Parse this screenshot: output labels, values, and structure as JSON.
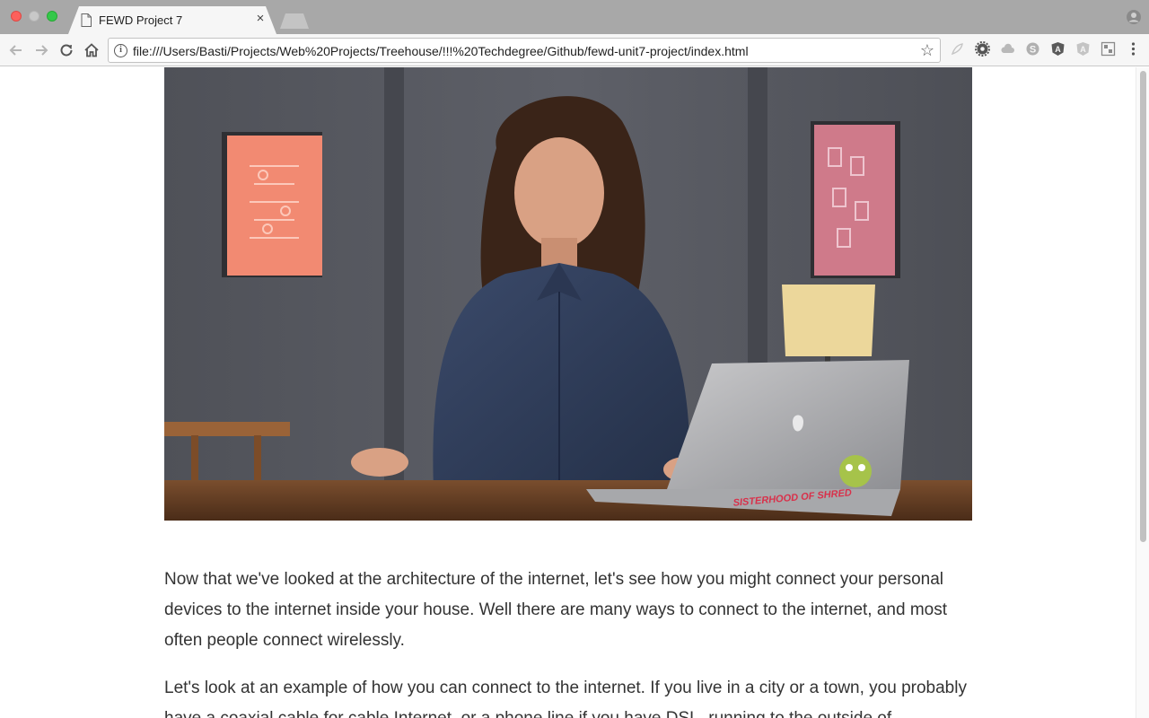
{
  "browser": {
    "tab_title": "FEWD Project 7",
    "tab_close": "×",
    "url": "file:///Users/Basti/Projects/Web%20Projects/Treehouse/!!!%20Techdegree/Github/fewd-unit7-project/index.html",
    "icons": {
      "back": "arrow-left-icon",
      "forward": "arrow-right-icon",
      "reload": "reload-icon",
      "home": "home-icon",
      "info": "info-icon",
      "bookmark": "star-icon",
      "profile": "person-icon"
    },
    "extensions": [
      "feather-icon",
      "gear-icon",
      "cloud-icon",
      "skype-icon",
      "angular-icon",
      "angular-outline-icon",
      "grid-icon",
      "menu-dots-icon"
    ]
  },
  "page": {
    "video_still": {
      "sticker_text": "SISTERHOOD OF SHRED"
    },
    "paragraphs": [
      "Now that we've looked at the architecture of the internet, let's see how you might connect your personal devices to the internet inside your house. Well there are many ways to connect to the internet, and most often people connect wirelessly.",
      "Let's look at an example of how you can connect to the internet. If you live in a city or a town, you probably have a coaxial cable for cable Internet, or a phone line if you have DSL, running to the outside of"
    ]
  },
  "colors": {
    "text": "#333333",
    "traffic_red": "#fc605c",
    "traffic_green": "#34c84a",
    "tabstrip": "#a8a8a8"
  }
}
